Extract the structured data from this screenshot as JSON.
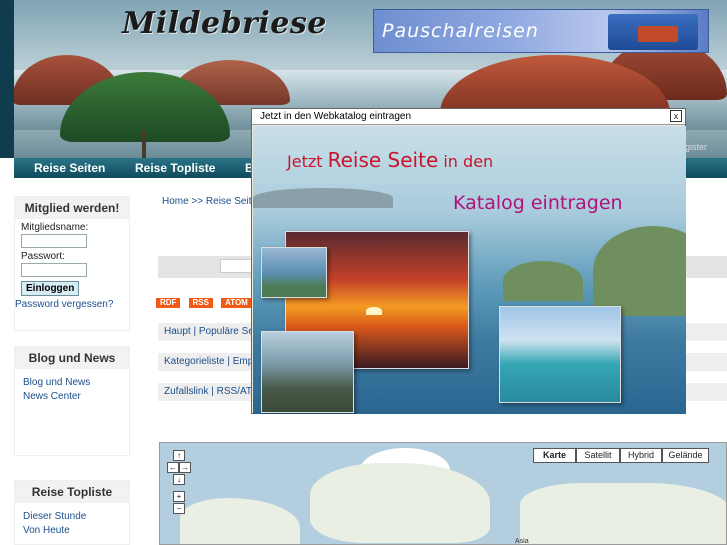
{
  "header": {
    "site_title": "Mildebriese",
    "banner_text": "Pauschalreisen"
  },
  "nav": {
    "items": [
      "Reise Seiten",
      "Reise Topliste",
      "B"
    ],
    "register_text": "gister"
  },
  "login_box": {
    "title": "Mitglied werden!",
    "username_label": "Mitgliedsname:",
    "password_label": "Passwort:",
    "login_button": "Einloggen",
    "forgot_link": "Password vergessen?"
  },
  "blog_box": {
    "title": "Blog und News",
    "links": [
      "Blog und News",
      "News Center"
    ]
  },
  "toplist_box": {
    "title": "Reise Topliste",
    "links": [
      "Dieser Stunde",
      "Von Heute"
    ]
  },
  "main": {
    "breadcrumb": "Home >> Reise Seite",
    "feeds": [
      "RDF",
      "RSS",
      "ATOM"
    ],
    "link_rows": [
      "Haupt  |  Populäre Se",
      "Kategorieliste  |  Emp",
      "Zufallslink  |  RSS/AT"
    ]
  },
  "map": {
    "types": [
      "Karte",
      "Satellit",
      "Hybrid",
      "Gelände"
    ],
    "selected_type": "Karte",
    "controls": [
      "↑",
      "←",
      "→",
      "↓",
      "+",
      "−"
    ],
    "label": "Asia"
  },
  "popup": {
    "title": "Jetzt in den Webkatalog eintragen",
    "close": "x",
    "headline_part1": "Jetzt",
    "headline_emph": "Reise Seite",
    "headline_part2": "in den",
    "headline_line2": "Katalog eintragen"
  }
}
